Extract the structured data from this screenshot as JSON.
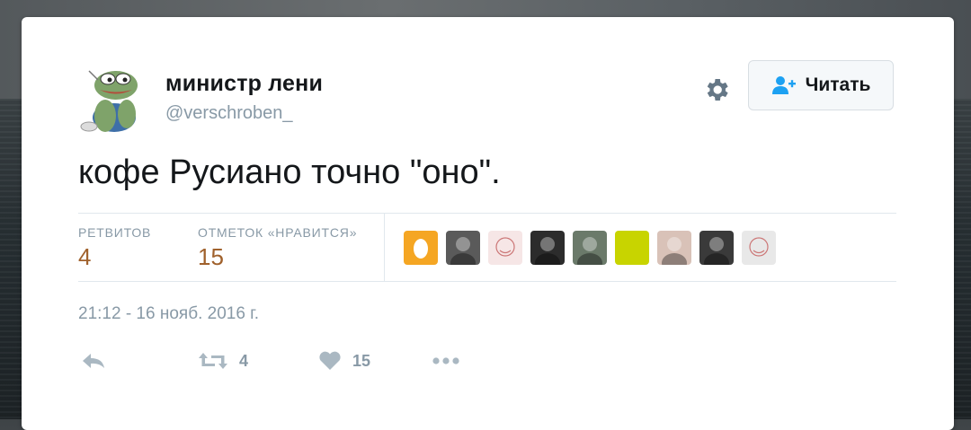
{
  "user": {
    "display_name": "министр лени",
    "handle": "@verschroben_"
  },
  "follow_button": {
    "label": "Читать"
  },
  "tweet": {
    "text": "кофе Русиано точно \"оно\"."
  },
  "stats": {
    "retweets_label": "РЕТВИТОВ",
    "retweets_value": "4",
    "likes_label": "ОТМЕТОК «НРАВИТСЯ»",
    "likes_value": "15"
  },
  "likers": [
    {
      "icon": "egg-avatar",
      "color": "#f5a623"
    },
    {
      "icon": "photo-avatar",
      "color": "#5a5a5a"
    },
    {
      "icon": "sketch-avatar",
      "color": "#f6e6e6"
    },
    {
      "icon": "photo-avatar",
      "color": "#2c2c2c"
    },
    {
      "icon": "photo-avatar",
      "color": "#6b7a6a"
    },
    {
      "icon": "solid-avatar",
      "color": "#c8d400"
    },
    {
      "icon": "photo-avatar",
      "color": "#d9c2b8"
    },
    {
      "icon": "photo-avatar",
      "color": "#3a3a3a"
    },
    {
      "icon": "sketch-avatar",
      "color": "#e8e8e8"
    }
  ],
  "timestamp": "21:12 - 16 нояб. 2016 г.",
  "actions": {
    "retweet_count": "4",
    "like_count": "15"
  },
  "colors": {
    "stat_value": "#a0612c",
    "muted": "#8899a6",
    "follow_icon": "#1da1f2"
  }
}
